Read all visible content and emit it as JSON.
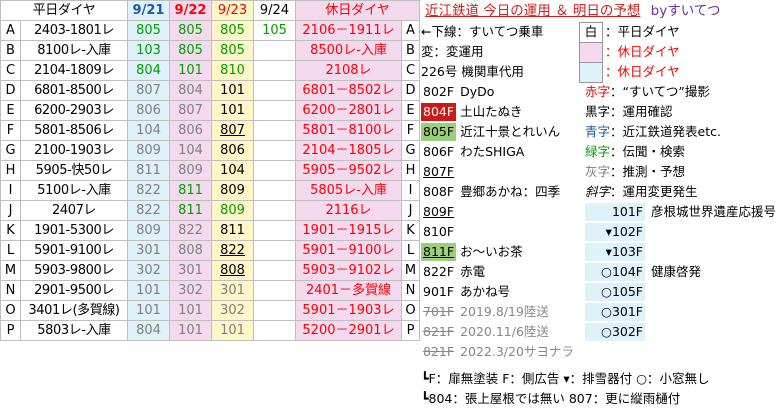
{
  "header": {
    "weekday": "平日ダイヤ",
    "d1": "9/21",
    "d2": "9/22",
    "d3": "9/23",
    "d4": "9/24",
    "holiday": "休日ダイヤ"
  },
  "rows": [
    {
      "l": "A",
      "t": "2403-1801レ",
      "v": [
        "805",
        "805",
        "805",
        "105"
      ],
      "h": "2106－1911レ"
    },
    {
      "l": "B",
      "t": "8100レ-入庫",
      "v": [
        "103",
        "805",
        "805",
        ""
      ],
      "h": "8500レ-入庫"
    },
    {
      "l": "C",
      "t": "2104-1809レ",
      "v": [
        "804",
        "101",
        "810",
        ""
      ],
      "h": "2108レ"
    },
    {
      "l": "D",
      "t": "6801-8500レ",
      "v": [
        "807",
        "804",
        "101",
        ""
      ],
      "h": "6801－8502レ"
    },
    {
      "l": "E",
      "t": "6200-2903レ",
      "v": [
        "806",
        "807",
        "101",
        ""
      ],
      "h": "6200－2801レ"
    },
    {
      "l": "F",
      "t": "5801-8506レ",
      "v": [
        "104",
        "806",
        "807",
        ""
      ],
      "h": "5801－8100レ"
    },
    {
      "l": "G",
      "t": "2100-1903レ",
      "v": [
        "809",
        "104",
        "806",
        ""
      ],
      "h": "2104－1805レ"
    },
    {
      "l": "H",
      "t": "5905-快50レ",
      "v": [
        "811",
        "809",
        "104",
        ""
      ],
      "h": "5905－9502レ"
    },
    {
      "l": "I",
      "t": "5100レ-入庫",
      "v": [
        "822",
        "811",
        "809",
        ""
      ],
      "h": "5805レ-入庫"
    },
    {
      "l": "J",
      "t": "2407レ",
      "v": [
        "822",
        "811",
        "809",
        ""
      ],
      "h": "2116レ"
    },
    {
      "l": "K",
      "t": "1901-5300レ",
      "v": [
        "809",
        "822",
        "811",
        ""
      ],
      "h": "1901－1915レ"
    },
    {
      "l": "L",
      "t": "5901-9100レ",
      "v": [
        "301",
        "808",
        "822",
        ""
      ],
      "h": "5901－9100レ"
    },
    {
      "l": "M",
      "t": "5903-9800レ",
      "v": [
        "302",
        "301",
        "808",
        ""
      ],
      "h": "5903－9102レ"
    },
    {
      "l": "N",
      "t": "2901-9500レ",
      "v": [
        "101",
        "302",
        "301",
        ""
      ],
      "h": "2401－多賀線"
    },
    {
      "l": "O",
      "t": "3401レ(多賀線)",
      "v": [
        "101",
        "101",
        "302",
        ""
      ],
      "h": "5901－1903レ"
    },
    {
      "l": "P",
      "t": "5803レ-入庫",
      "v": [
        "804",
        "101",
        "101",
        ""
      ],
      "h": "5200－2901レ"
    }
  ],
  "legend": {
    "title": "近江鉄道 今日の運用 ＆ 明日の予想",
    "by": "byすいてつ",
    "l1": "←下線：すいてつ乗車",
    "l2": "変：変運用",
    "l3": "226号 機関車代用",
    "shiro": "白",
    "key1a": "：平日ダイヤ",
    "key1b": "：休日ダイヤ",
    "key1c": "：休日ダイヤ",
    "cars": [
      {
        "n": "802F",
        "d": "DyDo"
      },
      {
        "n": "804F",
        "d": "土山たぬき"
      },
      {
        "n": "805F",
        "d": "近江十景とれいん"
      },
      {
        "n": "806F",
        "d": "わたSHIGA"
      },
      {
        "n": "807F",
        "d": ""
      },
      {
        "n": "808F",
        "d": "豊郷あかね：四季"
      },
      {
        "n": "809F",
        "d": ""
      },
      {
        "n": "810F",
        "d": ""
      },
      {
        "n": "811F",
        "d": "お〜いお茶"
      },
      {
        "n": "822F",
        "d": "赤電"
      },
      {
        "n": "901F",
        "d": "あかね号"
      },
      {
        "n": "701F",
        "d": "2019.8/19陸送"
      },
      {
        "n": "821F",
        "d": "2020.11/6陸送"
      },
      {
        "n": "821F",
        "d": "2022.3/20サヨナラ"
      }
    ],
    "colorkeys": [
      {
        "k": "赤字",
        "d": "：“すいてつ”撮影"
      },
      {
        "k": "黒字",
        "d": "：運用確認"
      },
      {
        "k": "青字",
        "d": "：近江鉄道発表etc."
      },
      {
        "k": "緑字",
        "d": "：伝聞・検索"
      },
      {
        "k": "灰字",
        "d": "：推測・予想"
      },
      {
        "k": "斜字",
        "d": "：運用変更発生"
      }
    ],
    "series100": [
      {
        "n": "101F",
        "d": "彦根城世界遺産応援号"
      },
      {
        "n": "▾102F",
        "d": ""
      },
      {
        "n": "▾103F",
        "d": ""
      },
      {
        "n": "○104F",
        "d": "健康啓発"
      },
      {
        "n": "○105F",
        "d": ""
      },
      {
        "n": "○301F",
        "d": ""
      },
      {
        "n": "○302F",
        "d": ""
      }
    ],
    "note1": "┗F：扉無塗装 F：側広告 ▾：排雪器付 ○：小窓無し",
    "note2": "┗804：張上屋根では無い 807：更に縦雨樋付"
  }
}
